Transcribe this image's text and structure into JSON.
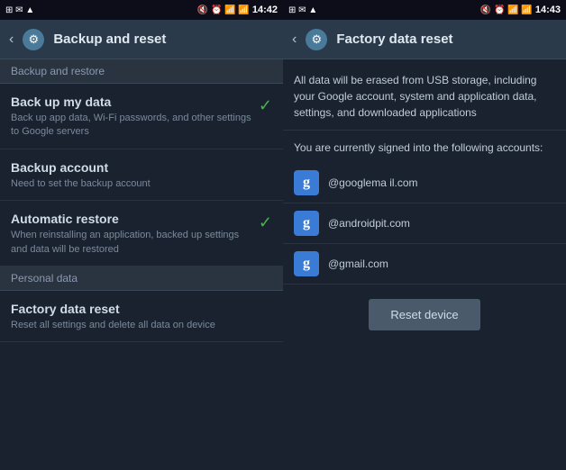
{
  "leftScreen": {
    "statusBar": {
      "leftIcons": "⊞ ✉ ▲",
      "rightIcons": "🔇 ⏰ 📶 📶",
      "time": "14:42"
    },
    "header": {
      "title": "Backup and reset",
      "backIcon": "‹",
      "gearIcon": "⚙"
    },
    "sections": [
      {
        "type": "section-header",
        "label": "Backup and restore"
      },
      {
        "type": "setting",
        "title": "Back up my data",
        "desc": "Back up app data, Wi-Fi passwords, and other settings to Google servers",
        "hasCheck": true
      },
      {
        "type": "setting",
        "title": "Backup account",
        "desc": "Need to set the backup account",
        "hasCheck": false
      },
      {
        "type": "setting",
        "title": "Automatic restore",
        "desc": "When reinstalling an application, backed up settings and data will be restored",
        "hasCheck": true
      },
      {
        "type": "section-header",
        "label": "Personal data"
      },
      {
        "type": "setting",
        "title": "Factory data reset",
        "desc": "Reset all settings and delete all data on device",
        "hasCheck": false
      }
    ]
  },
  "rightScreen": {
    "statusBar": {
      "leftIcons": "⊞ ✉ ▲",
      "rightIcons": "🔇 ⏰ 📶 📶",
      "time": "14:43"
    },
    "header": {
      "title": "Factory data reset",
      "backIcon": "‹",
      "gearIcon": "⚙"
    },
    "warningText": "All data will be erased from USB storage, including your Google account, system and application data, settings, and downloaded applications",
    "accountsIntro": "You are currently signed into the following accounts:",
    "accounts": [
      {
        "icon": "g",
        "email": "@googlema il.com"
      },
      {
        "icon": "g",
        "email": "@androidpit.com"
      },
      {
        "icon": "g",
        "email": "@gmail.com"
      }
    ],
    "resetButtonLabel": "Reset device"
  }
}
